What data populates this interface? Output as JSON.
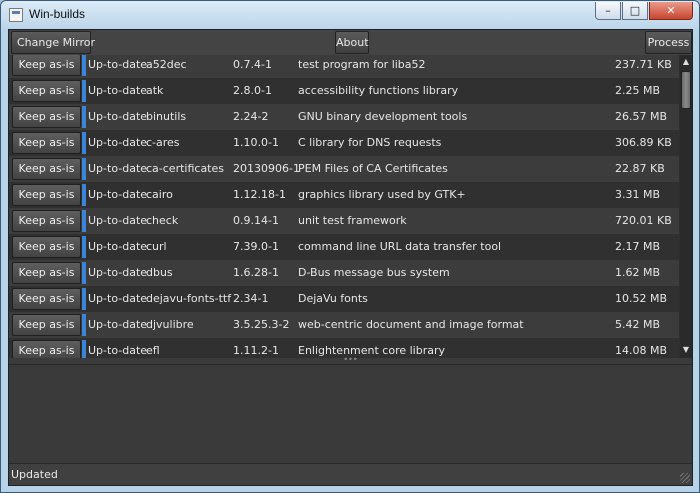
{
  "window": {
    "title": "Win-builds",
    "controls": {
      "minimize": "–",
      "maximize": "□",
      "close": "✕"
    }
  },
  "toolbar": {
    "change_mirror": "Change Mirror",
    "about": "About",
    "process": "Process"
  },
  "packages": [
    {
      "action": "Keep as-is",
      "status": "Up-to-date",
      "name": "a52dec",
      "version": "0.7.4-1",
      "description": "test program for liba52",
      "size": "237.71 KB"
    },
    {
      "action": "Keep as-is",
      "status": "Up-to-date",
      "name": "atk",
      "version": "2.8.0-1",
      "description": "accessibility functions library",
      "size": "2.25 MB"
    },
    {
      "action": "Keep as-is",
      "status": "Up-to-date",
      "name": "binutils",
      "version": "2.24-2",
      "description": "GNU binary development tools",
      "size": "26.57 MB"
    },
    {
      "action": "Keep as-is",
      "status": "Up-to-date",
      "name": "c-ares",
      "version": "1.10.0-1",
      "description": "C library for DNS requests",
      "size": "306.89 KB"
    },
    {
      "action": "Keep as-is",
      "status": "Up-to-date",
      "name": "ca-certificates",
      "version": "20130906-1",
      "description": "PEM Files of CA Certificates",
      "size": "22.87 KB"
    },
    {
      "action": "Keep as-is",
      "status": "Up-to-date",
      "name": "cairo",
      "version": "1.12.18-1",
      "description": "graphics library used by GTK+",
      "size": "3.31 MB"
    },
    {
      "action": "Keep as-is",
      "status": "Up-to-date",
      "name": "check",
      "version": "0.9.14-1",
      "description": "unit test framework",
      "size": "720.01 KB"
    },
    {
      "action": "Keep as-is",
      "status": "Up-to-date",
      "name": "curl",
      "version": "7.39.0-1",
      "description": "command line URL data transfer tool",
      "size": "2.17 MB"
    },
    {
      "action": "Keep as-is",
      "status": "Up-to-date",
      "name": "dbus",
      "version": "1.6.28-1",
      "description": "D-Bus message bus system",
      "size": "1.62 MB"
    },
    {
      "action": "Keep as-is",
      "status": "Up-to-date",
      "name": "dejavu-fonts-ttf",
      "version": "2.34-1",
      "description": "DejaVu fonts",
      "size": "10.52 MB"
    },
    {
      "action": "Keep as-is",
      "status": "Up-to-date",
      "name": "djvulibre",
      "version": "3.5.25.3-2",
      "description": "web-centric document and image format",
      "size": "5.42 MB"
    },
    {
      "action": "Keep as-is",
      "status": "Up-to-date",
      "name": "efl",
      "version": "1.11.2-1",
      "description": "Enlightenment core library",
      "size": "14.08 MB"
    }
  ],
  "scrollbar": {
    "up_icon": "▲",
    "down_icon": "▼"
  },
  "splitter_icon": "•••",
  "status": {
    "text": "Updated"
  },
  "colors": {
    "accent": "#3b84d6",
    "background": "#3b3b3b"
  }
}
